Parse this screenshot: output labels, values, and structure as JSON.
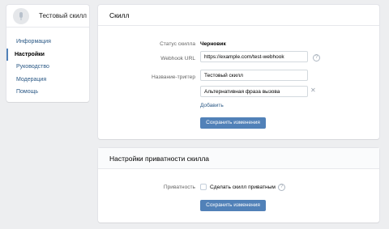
{
  "sidebar": {
    "title": "Тестовый скилл",
    "items": [
      {
        "label": "Информация",
        "active": false
      },
      {
        "label": "Настройки",
        "active": true
      },
      {
        "label": "Руководство",
        "active": false
      },
      {
        "label": "Модерация",
        "active": false
      },
      {
        "label": "Помощь",
        "active": false
      }
    ]
  },
  "skill": {
    "header": "Скилл",
    "status_label": "Статус скилла",
    "status_value": "Черновик",
    "webhook_label": "Webhook URL",
    "webhook_value": "https://example.com/test-webhook",
    "trigger_label": "Название-триггер",
    "trigger_value": "Тестовый скилл",
    "alt_phrase_value": "Альтернативная фраза вызова",
    "add_link": "Добавить",
    "save_button": "Сохранить изменения"
  },
  "privacy": {
    "header": "Настройки приватности скилла",
    "privacy_label": "Приватность",
    "checkbox_label": "Сделать скилл приватным",
    "checkbox_checked": false,
    "save_button": "Сохранить изменения"
  },
  "colors": {
    "accent": "#5181b8",
    "link": "#2a5885",
    "background": "#edeef0"
  },
  "icons": {
    "help": "question-circle-icon",
    "remove": "close-icon",
    "avatar": "microphone-icon"
  }
}
